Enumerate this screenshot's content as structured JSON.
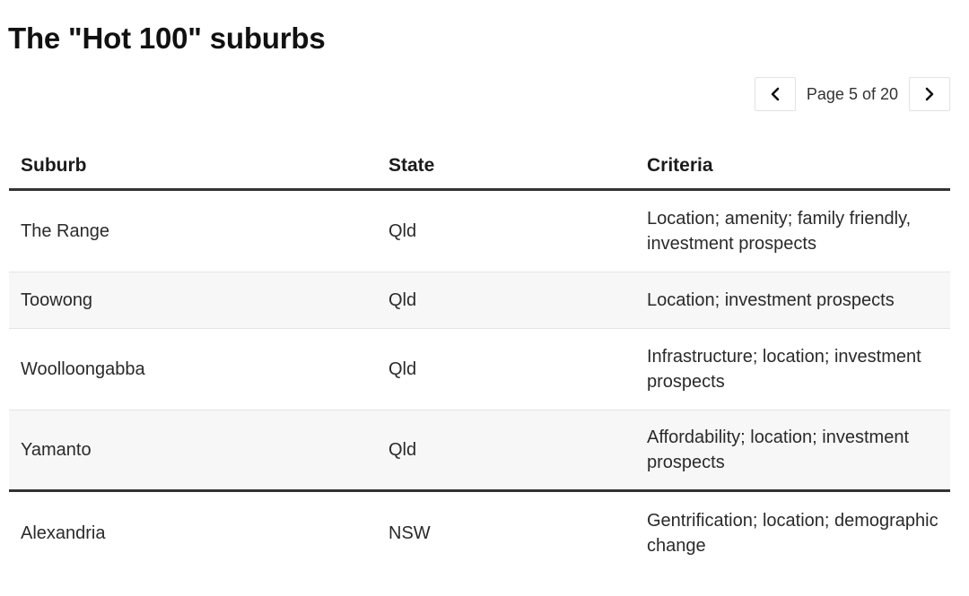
{
  "page": {
    "title": "The \"Hot 100\" suburbs"
  },
  "pagination": {
    "label": "Page 5 of 20",
    "prev_icon": "chevron-left-icon",
    "next_icon": "chevron-right-icon"
  },
  "table": {
    "headers": {
      "suburb": "Suburb",
      "state": "State",
      "criteria": "Criteria"
    },
    "rows": [
      {
        "suburb": "The Range",
        "state": "Qld",
        "criteria": "Location; amenity; family friendly, investment prospects"
      },
      {
        "suburb": "Toowong",
        "state": "Qld",
        "criteria": "Location; investment prospects"
      },
      {
        "suburb": "Woolloongabba",
        "state": "Qld",
        "criteria": "Infrastructure; location; investment prospects"
      },
      {
        "suburb": "Yamanto",
        "state": "Qld",
        "criteria": "Affordability; location; investment prospects"
      },
      {
        "suburb": "Alexandria",
        "state": "NSW",
        "criteria": "Gentrification; location; demographic change"
      }
    ]
  },
  "colors": {
    "text": "#212121",
    "rule": "#333333",
    "row_alt": "#f7f7f7",
    "divider": "#e4e4e4"
  }
}
